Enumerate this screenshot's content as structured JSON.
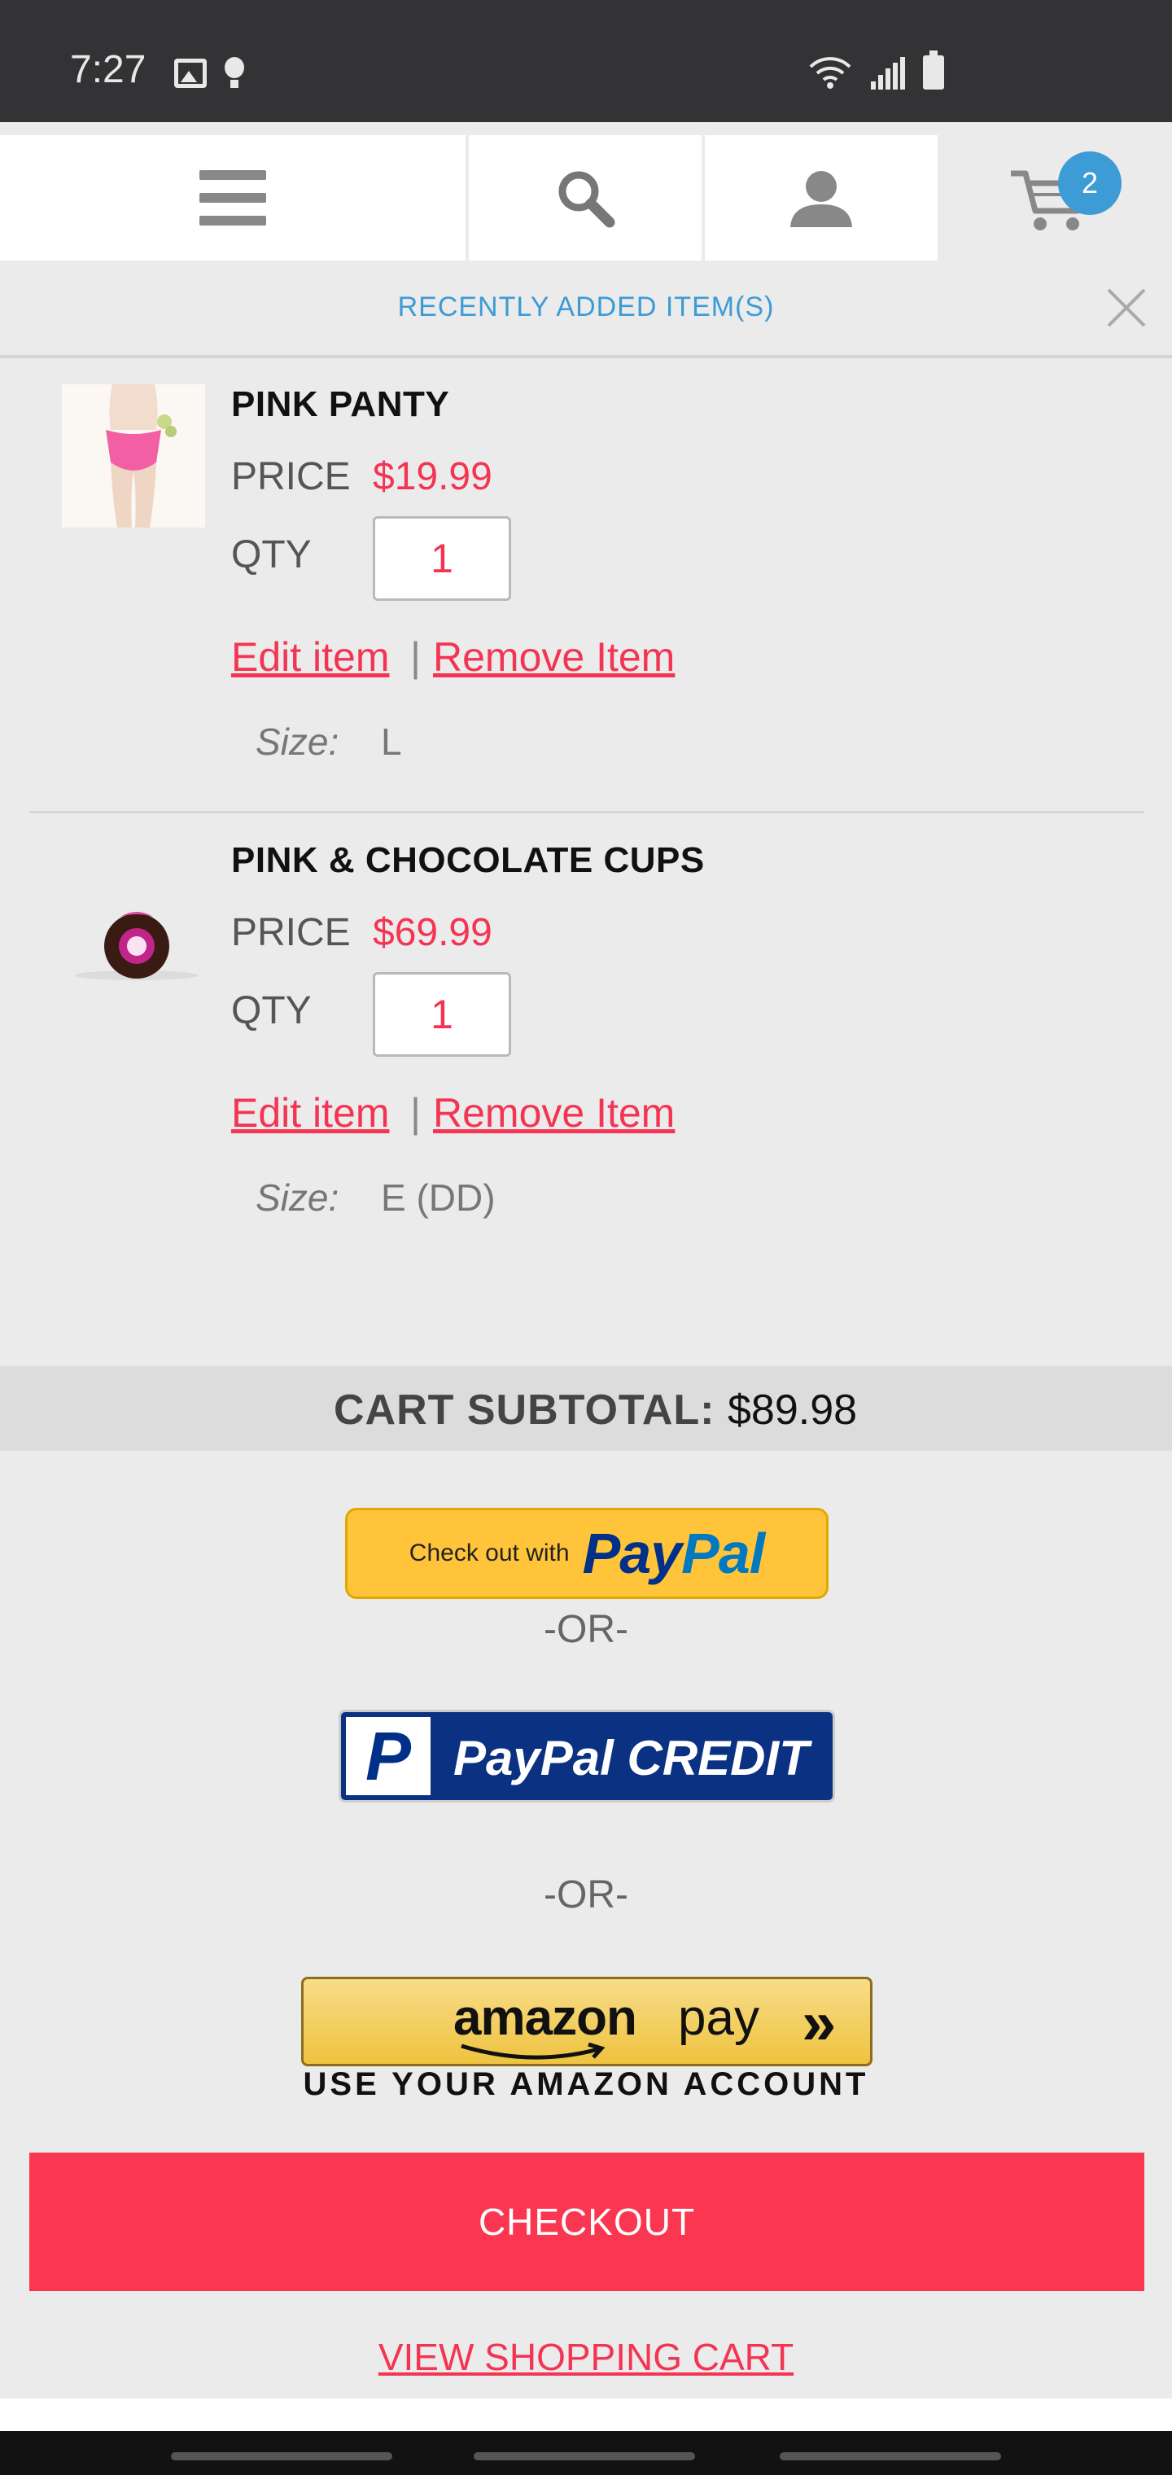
{
  "status_bar": {
    "time": "7:27"
  },
  "cart": {
    "count": "2"
  },
  "recent": {
    "title": "RECENTLY ADDED ITEM(S)"
  },
  "items": [
    {
      "name": "PINK PANTY",
      "price_label": "PRICE",
      "price": "$19.99",
      "qty_label": "QTY",
      "qty": "1",
      "edit_label": "Edit item ",
      "separator": "|",
      "remove_label": "Remove Item",
      "size_label": "Size:",
      "size": "L"
    },
    {
      "name": "PINK & CHOCOLATE CUPS",
      "price_label": "PRICE",
      "price": "$69.99",
      "qty_label": "QTY",
      "qty": "1",
      "edit_label": "Edit item ",
      "separator": "|",
      "remove_label": "Remove Item",
      "size_label": "Size:",
      "size": "E (DD)"
    }
  ],
  "subtotal": {
    "label": "CART SUBTOTAL:",
    "value": "$89.98"
  },
  "paypal": {
    "small_text": "Check out with",
    "logo_pay": "Pay",
    "logo_pal": "Pal"
  },
  "or_text": "-OR-",
  "paypal_credit": {
    "p": "P",
    "text": "PayPal CREDIT"
  },
  "amazon": {
    "brand": "amazon",
    "pay": "pay",
    "arrows": "»",
    "caption": "USE YOUR AMAZON ACCOUNT"
  },
  "checkout": {
    "label": "CHECKOUT"
  },
  "view_cart": {
    "label": "VIEW SHOPPING CART"
  },
  "colors": {
    "accent": "#f43453",
    "checkout_bg": "#fb3651",
    "badge": "#3d9bd6",
    "paypal_yellow": "#ffc439",
    "paypal_credit_blue": "#0b3182"
  }
}
